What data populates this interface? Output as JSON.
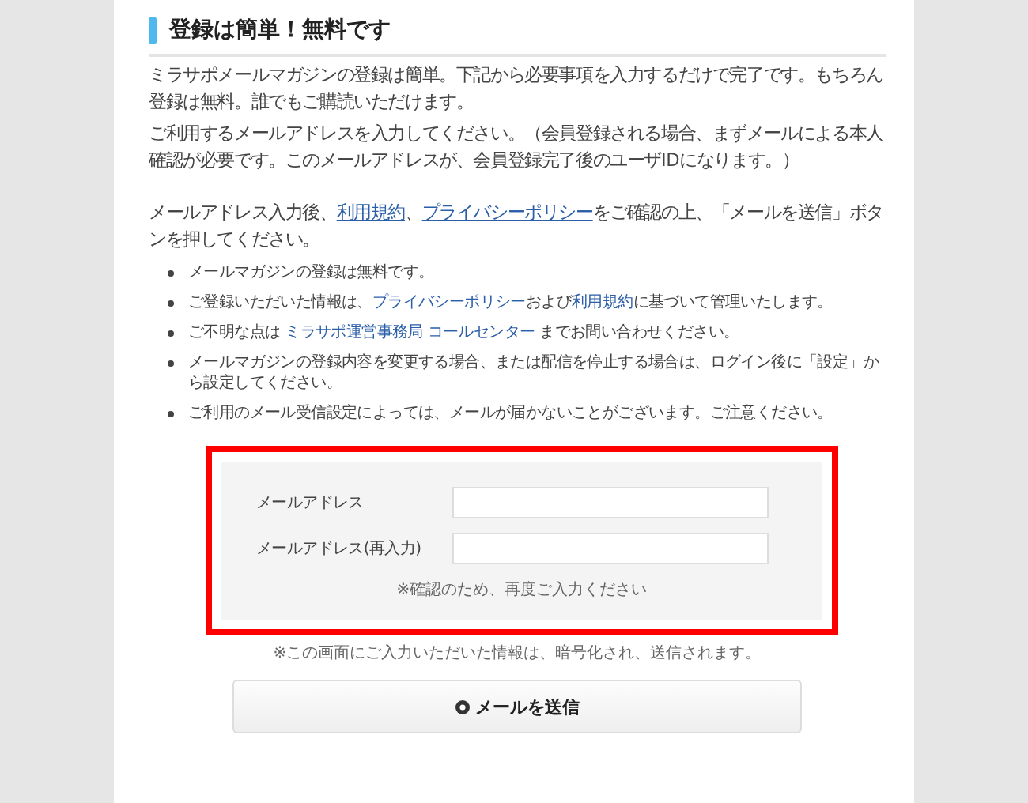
{
  "heading": "登録は簡単！無料です",
  "paragraphs": [
    [
      {
        "kind": "text",
        "text": "ミラサポメールマガジンの登録は簡単。下記から必要事項を入力するだけで完了です。もちろん登録は無料。誰でもご購読いただけます。"
      }
    ],
    [
      {
        "kind": "text",
        "text": "ご利用するメールアドレスを入力してください。（会員登録される場合、まずメールによる本人確認が必要です。このメールアドレスが、会員登録完了後のユーザIDになります。）"
      }
    ],
    [
      {
        "kind": "text",
        "text": "メールアドレス入力後、"
      },
      {
        "kind": "link",
        "text": "利用規約"
      },
      {
        "kind": "text",
        "text": "、"
      },
      {
        "kind": "link",
        "text": "プライバシーポリシー"
      },
      {
        "kind": "text",
        "text": "をご確認の上、「メールを送信」ボタンを押してください。"
      }
    ]
  ],
  "notes": [
    [
      {
        "kind": "text",
        "text": "メールマガジンの登録は無料です。"
      }
    ],
    [
      {
        "kind": "text",
        "text": "ご登録いただいた情報は、"
      },
      {
        "kind": "link",
        "text": "プライバシーポリシー"
      },
      {
        "kind": "text",
        "text": "および"
      },
      {
        "kind": "link",
        "text": "利用規約"
      },
      {
        "kind": "text",
        "text": "に基づいて管理いたします。"
      }
    ],
    [
      {
        "kind": "text",
        "text": "ご不明な点は "
      },
      {
        "kind": "link",
        "text": "ミラサポ運営事務局 コールセンター"
      },
      {
        "kind": "text",
        "text": " までお問い合わせください。"
      }
    ],
    [
      {
        "kind": "text",
        "text": "メールマガジンの登録内容を変更する場合、または配信を停止する場合は、ログイン後に「設定」から設定してください。"
      }
    ],
    [
      {
        "kind": "text",
        "text": "ご利用のメール受信設定によっては、メールが届かないことがございます。ご注意ください。"
      }
    ]
  ],
  "form": {
    "fields": [
      {
        "label": "メールアドレス"
      },
      {
        "label": "メールアドレス(再入力)"
      }
    ],
    "hint": "※確認のため、再度ご入力ください"
  },
  "encryption_note": "※この画面にご入力いただいた情報は、暗号化され、送信されます。",
  "submit_button": "メールを送信"
}
